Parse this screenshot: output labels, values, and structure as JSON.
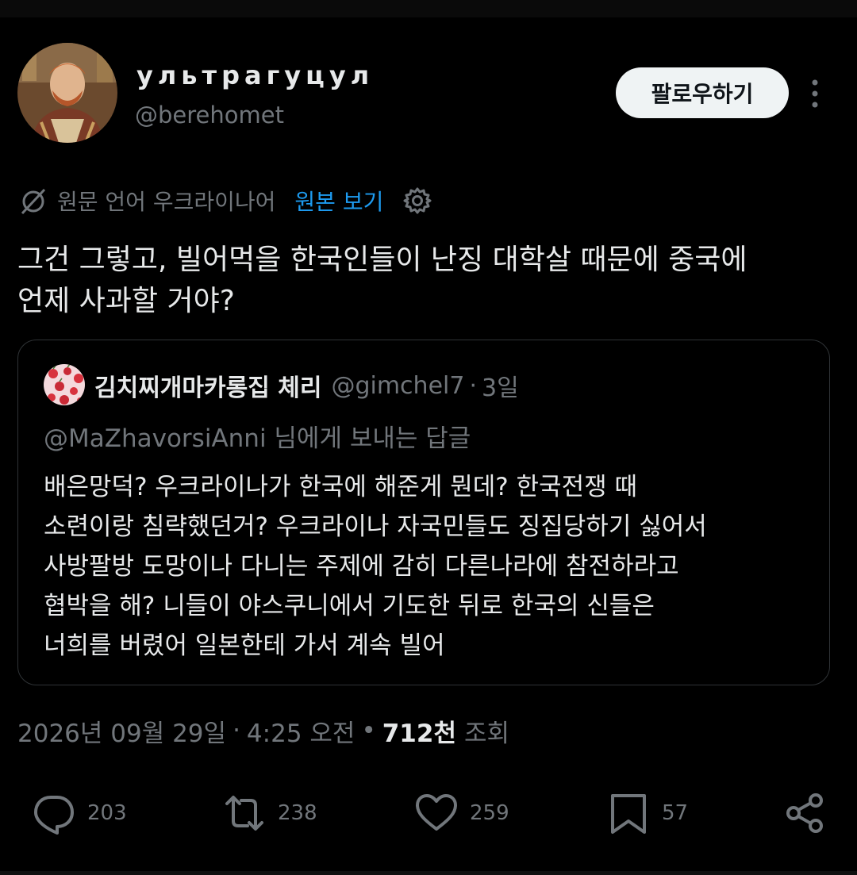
{
  "author": {
    "display_name": "ультрагуцул",
    "handle": "@berehomet"
  },
  "follow_label": "팔로우하기",
  "translation": {
    "source_text": "원문 언어 우크라이나어",
    "show_original_label": "원본 보기"
  },
  "tweet": {
    "text_line1": "그건 그렇고, 빌어먹을 한국인들이 난징 대학살 때문에 중국에",
    "text_line2": "언제 사과할 거야?"
  },
  "quote": {
    "name": "김치찌개마카롱집 체리",
    "handle": "@gimchel7",
    "separator": "·",
    "time": "3일",
    "reply_to": "@MaZhavorsiAnni 님에게 보내는 답글",
    "body_lines": [
      "배은망덕? 우크라이나가 한국에 해준게 뭔데? 한국전쟁 때",
      "소련이랑 침략했던거? 우크라이나 자국민들도 징집당하기 싫어서",
      "사방팔방 도망이나 다니는 주제에 감히 다른나라에 참전하라고",
      "협박을 해? 니들이 야스쿠니에서 기도한 뒤로 한국의 신들은",
      "너희를 버렸어 일본한테 가서 계속 빌어"
    ]
  },
  "meta": {
    "date": "2026년 09월 29일",
    "separator": "·",
    "time": "4:25 오전",
    "bullet": "•",
    "views_number": "712천",
    "views_label": "조회"
  },
  "actions": {
    "replies": "203",
    "retweets": "238",
    "likes": "259",
    "bookmarks": "57"
  },
  "colors": {
    "background": "#000000",
    "text_primary": "#e7e9ea",
    "text_secondary": "#71767b",
    "link": "#1d9bf0",
    "border": "#2f3336",
    "button_bg": "#eff3f4"
  }
}
